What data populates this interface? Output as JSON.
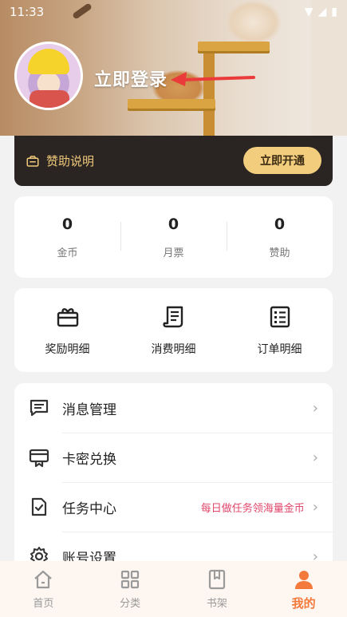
{
  "status_bar": {
    "time": "11:33"
  },
  "header": {
    "login_text": "立即登录"
  },
  "sponsor": {
    "label": "赞助说明",
    "button": "立即开通"
  },
  "stats": [
    {
      "value": "0",
      "label": "金币"
    },
    {
      "value": "0",
      "label": "月票"
    },
    {
      "value": "0",
      "label": "赞助"
    }
  ],
  "quick": [
    {
      "label": "奖励明细",
      "icon": "gift-box-icon"
    },
    {
      "label": "消费明细",
      "icon": "receipt-icon"
    },
    {
      "label": "订单明细",
      "icon": "order-list-icon"
    }
  ],
  "menu": [
    {
      "label": "消息管理",
      "icon": "message-icon",
      "extra": ""
    },
    {
      "label": "卡密兑换",
      "icon": "card-redeem-icon",
      "extra": ""
    },
    {
      "label": "任务中心",
      "icon": "task-check-icon",
      "extra": "每日做任务领海量金币"
    },
    {
      "label": "账号设置",
      "icon": "settings-gear-icon",
      "extra": ""
    }
  ],
  "tabbar": [
    {
      "label": "首页",
      "icon": "home-icon"
    },
    {
      "label": "分类",
      "icon": "category-grid-icon"
    },
    {
      "label": "书架",
      "icon": "bookshelf-icon"
    },
    {
      "label": "我的",
      "icon": "user-icon",
      "active": true
    }
  ],
  "colors": {
    "accent": "#f47a3c",
    "sponsor_bg": "#2a2522",
    "sponsor_gold": "#f0c97a",
    "task_highlight": "#e0466a"
  }
}
